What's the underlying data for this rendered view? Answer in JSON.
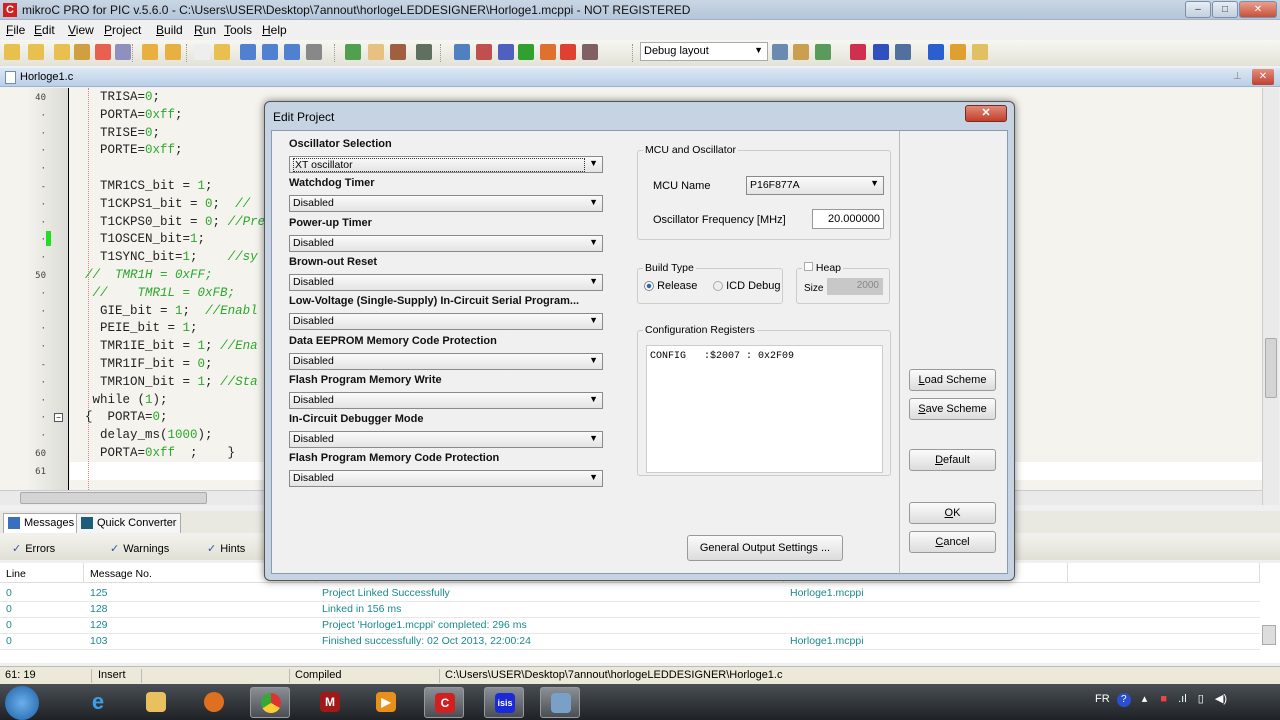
{
  "window": {
    "title": "mikroC PRO for PIC v.5.6.0 - C:\\Users\\USER\\Desktop\\7annout\\horlogeLEDDESIGNER\\Horloge1.mcppi - NOT REGISTERED",
    "app_icon": "C",
    "controls": [
      "–",
      "□",
      "✕"
    ]
  },
  "menu": [
    {
      "u": "F",
      "rest": "ile"
    },
    {
      "u": "E",
      "rest": "dit"
    },
    {
      "u": "V",
      "rest": "iew"
    },
    {
      "u": "P",
      "rest": "roject"
    },
    {
      "u": "B",
      "rest": "uild"
    },
    {
      "u": "R",
      "rest": "un"
    },
    {
      "u": "T",
      "rest": "ools"
    },
    {
      "u": "H",
      "rest": "elp"
    }
  ],
  "toolbar": {
    "layout_select": "Debug layout"
  },
  "editor": {
    "tab": "Horloge1.c",
    "lines": [
      {
        "n": "40",
        "s": [
          [
            "k",
            "    TRISA="
          ],
          [
            "g",
            "0"
          ],
          [
            "k",
            ";"
          ]
        ]
      },
      {
        "n": "·",
        "s": [
          [
            "k",
            "    PORTA="
          ],
          [
            "g",
            "0xff"
          ],
          [
            "k",
            ";"
          ]
        ]
      },
      {
        "n": "·",
        "s": [
          [
            "k",
            "    TRISE="
          ],
          [
            "g",
            "0"
          ],
          [
            "k",
            ";"
          ]
        ]
      },
      {
        "n": "·",
        "s": [
          [
            "k",
            "    PORTE="
          ],
          [
            "g",
            "0xff"
          ],
          [
            "k",
            ";"
          ]
        ]
      },
      {
        "n": "·",
        "s": []
      },
      {
        "n": "-",
        "s": [
          [
            "k",
            "    TMR1CS_bit = "
          ],
          [
            "g",
            "1"
          ],
          [
            "k",
            ";"
          ]
        ]
      },
      {
        "n": "·",
        "s": [
          [
            "k",
            "    T1CKPS1_bit = "
          ],
          [
            "g",
            "0"
          ],
          [
            "k",
            ";  "
          ],
          [
            "c",
            "//"
          ]
        ]
      },
      {
        "n": "·",
        "s": [
          [
            "k",
            "    T1CKPS0_bit = "
          ],
          [
            "g",
            "0"
          ],
          [
            "k",
            "; "
          ],
          [
            "c",
            "//Pre"
          ]
        ]
      },
      {
        "n": "·",
        "s": [
          [
            "k",
            "    T1OSCEN_bit="
          ],
          [
            "g",
            "1"
          ],
          [
            "k",
            ";"
          ]
        ]
      },
      {
        "n": "·",
        "s": [
          [
            "k",
            "    T1SYNC_bit="
          ],
          [
            "g",
            "1"
          ],
          [
            "k",
            ";    "
          ],
          [
            "c",
            "//sy"
          ]
        ]
      },
      {
        "n": "50",
        "s": [
          [
            "c",
            "  //  TMR1H = 0xFF;"
          ]
        ]
      },
      {
        "n": "·",
        "s": [
          [
            "c",
            "   //    TMR1L = 0xFB;"
          ]
        ]
      },
      {
        "n": "·",
        "s": [
          [
            "k",
            "    GIE_bit = "
          ],
          [
            "g",
            "1"
          ],
          [
            "k",
            ";  "
          ],
          [
            "c",
            "//Enabl"
          ]
        ]
      },
      {
        "n": "·",
        "s": [
          [
            "k",
            "    PEIE_bit = "
          ],
          [
            "g",
            "1"
          ],
          [
            "k",
            ";"
          ]
        ]
      },
      {
        "n": "·",
        "s": [
          [
            "k",
            "    TMR1IE_bit = "
          ],
          [
            "g",
            "1"
          ],
          [
            "k",
            "; "
          ],
          [
            "c",
            "//Ena"
          ]
        ]
      },
      {
        "n": "-",
        "s": [
          [
            "k",
            "    TMR1IF_bit = "
          ],
          [
            "g",
            "0"
          ],
          [
            "k",
            ";"
          ]
        ]
      },
      {
        "n": "·",
        "s": [
          [
            "k",
            "    TMR1ON_bit = "
          ],
          [
            "g",
            "1"
          ],
          [
            "k",
            "; "
          ],
          [
            "c",
            "//Sta"
          ]
        ]
      },
      {
        "n": "·",
        "s": [
          [
            "k",
            "   while ("
          ],
          [
            "g",
            "1"
          ],
          [
            "k",
            ");"
          ]
        ]
      },
      {
        "n": "·",
        "s": [
          [
            "k",
            "  {  PORTA="
          ],
          [
            "g",
            "0"
          ],
          [
            "k",
            ";"
          ]
        ]
      },
      {
        "n": "·",
        "s": [
          [
            "k",
            "    delay_ms("
          ],
          [
            "g",
            "1000"
          ],
          [
            "k",
            ");"
          ]
        ]
      },
      {
        "n": "60",
        "s": [
          [
            "k",
            "    PORTA="
          ],
          [
            "g",
            "0xff"
          ],
          [
            "k",
            "  ;    }"
          ]
        ]
      },
      {
        "n": "61",
        "s": []
      }
    ]
  },
  "messages": {
    "tabs": [
      "Messages",
      "Quick Converter"
    ],
    "filters": [
      "Errors",
      "Warnings",
      "Hints"
    ],
    "columns": [
      "Line",
      "Message No."
    ],
    "rows": [
      {
        "line": "0",
        "no": "125",
        "text": "Project Linked Successfully",
        "file": "Horloge1.mcppi"
      },
      {
        "line": "0",
        "no": "128",
        "text": "Linked in 156 ms",
        "file": ""
      },
      {
        "line": "0",
        "no": "129",
        "text": "Project 'Horloge1.mcppi' completed: 296 ms",
        "file": ""
      },
      {
        "line": "0",
        "no": "103",
        "text": "Finished successfully: 02 Oct 2013, 22:00:24",
        "file": "Horloge1.mcppi"
      }
    ]
  },
  "statusbar": {
    "pos": "61: 19",
    "mode": "Insert",
    "state": "Compiled",
    "path": "C:\\Users\\USER\\Desktop\\7annout\\horlogeLEDDESIGNER\\Horloge1.c"
  },
  "taskbar": {
    "tray_lang": "FR"
  },
  "dialog": {
    "title": "Edit Project",
    "settings": [
      {
        "label": "Oscillator Selection",
        "value": "XT oscillator"
      },
      {
        "label": "Watchdog Timer",
        "value": "Disabled"
      },
      {
        "label": "Power-up Timer",
        "value": "Disabled"
      },
      {
        "label": "Brown-out Reset",
        "value": "Disabled"
      },
      {
        "label": "Low-Voltage (Single-Supply) In-Circuit Serial Program...",
        "value": "Disabled"
      },
      {
        "label": "Data EEPROM Memory Code Protection",
        "value": "Disabled"
      },
      {
        "label": "Flash Program Memory Write",
        "value": "Disabled"
      },
      {
        "label": "In-Circuit Debugger Mode",
        "value": "Disabled"
      },
      {
        "label": "Flash Program Memory Code Protection",
        "value": "Disabled"
      }
    ],
    "mcu_group": "MCU and Oscillator",
    "mcu_label": "MCU Name",
    "mcu_value": "P16F877A",
    "freq_label": "Oscillator Frequency [MHz]",
    "freq_value": "20.000000",
    "build_group": "Build Type",
    "release": "Release",
    "icd": "ICD Debug",
    "heap_label": "Heap",
    "size_label": "Size",
    "size_value": "2000",
    "config_group": "Configuration Registers",
    "config_text": "CONFIG   :$2007 : 0x2F09",
    "general_output": "General Output Settings ...",
    "load": {
      "u": "L",
      "rest": "oad Scheme"
    },
    "save": {
      "u": "S",
      "rest": "ave Scheme"
    },
    "default": {
      "u": "D",
      "rest": "efault"
    },
    "ok": {
      "u": "O",
      "rest": "K"
    },
    "cancel": {
      "u": "C",
      "rest": "ancel"
    }
  }
}
